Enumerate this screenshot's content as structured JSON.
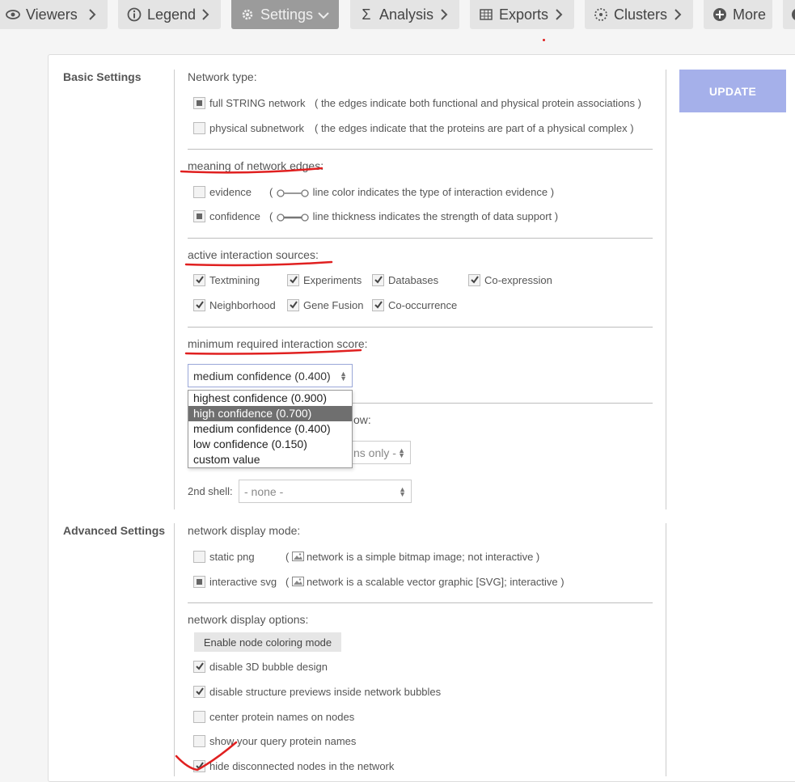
{
  "toolbar": {
    "viewers": "Viewers",
    "legend": "Legend",
    "settings": "Settings",
    "analysis": "Analysis",
    "exports": "Exports",
    "clusters": "Clusters",
    "more": "More"
  },
  "basic": {
    "title": "Basic Settings",
    "network_type": {
      "label": "Network type:",
      "full": "full STRING network",
      "full_hint": "( the edges indicate both functional and physical protein associations )",
      "physical": "physical subnetwork",
      "physical_hint": "( the edges indicate that the proteins are part of a physical complex )"
    },
    "edges": {
      "label": "meaning of network edges:",
      "evidence": "evidence",
      "evidence_hint": "line color indicates the type of interaction evidence )",
      "confidence": "confidence",
      "confidence_hint": "line thickness indicates the strength of data support )"
    },
    "sources": {
      "label": "active interaction sources:",
      "items": [
        "Textmining",
        "Experiments",
        "Databases",
        "Co-expression",
        "Neighborhood",
        "Gene Fusion",
        "Co-occurrence"
      ]
    },
    "score": {
      "label": "minimum required interaction score:",
      "selected": "medium confidence (0.400)",
      "options": [
        "highest confidence (0.900)",
        "high confidence (0.700)",
        "medium confidence (0.400)",
        "low confidence (0.150)",
        "custom value"
      ]
    },
    "max_interactors": {
      "label_tail": "ow:",
      "first_shell_value": "ns only -",
      "second_shell_label": "2nd shell:",
      "second_shell_value": "- none -"
    },
    "update": "UPDATE"
  },
  "advanced": {
    "title": "Advanced Settings",
    "display_mode": {
      "label": "network display mode:",
      "static": "static png",
      "static_hint": "network is a simple bitmap image; not interactive )",
      "svg": "interactive svg",
      "svg_hint": "network is a scalable vector graphic [SVG]; interactive )"
    },
    "display_options": {
      "label": "network display options:",
      "coloring_button": "Enable node coloring mode",
      "opt1": "disable 3D bubble design",
      "opt2": "disable structure previews inside network bubbles",
      "opt3": "center protein names on nodes",
      "opt4": "show your query protein names",
      "opt5": "hide disconnected nodes in the network"
    }
  },
  "colors": {
    "update_button": "#a5b0ea",
    "annotation_red": "#e02020",
    "active_tab": "#9b9b9b"
  }
}
